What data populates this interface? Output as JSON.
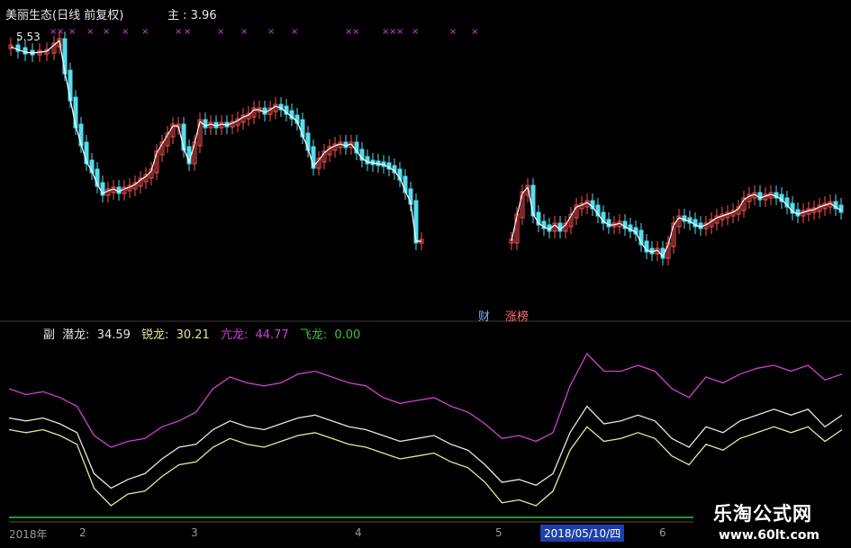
{
  "stock": {
    "title": "美丽生态(日线 前复权)",
    "main_label": "主 : 3.96",
    "price_high_label": "5.53"
  },
  "sub_indicators": {
    "panel_label": "副",
    "items": [
      {
        "label": "潜龙:",
        "value": "34.59",
        "color": "#e6e6e6"
      },
      {
        "label": "锐龙:",
        "value": "30.21",
        "color": "#e6e6a0"
      },
      {
        "label": "亢龙:",
        "value": "44.77",
        "color": "#d040d0"
      },
      {
        "label": "飞龙:",
        "value": "0.00",
        "color": "#40c040"
      }
    ]
  },
  "event_tags": {
    "finance": "财",
    "limit_list": "涨榜"
  },
  "date_axis": {
    "ticks": [
      "2018年",
      "2",
      "3",
      "4",
      "5",
      "6"
    ],
    "selected_date": "2018/05/10/四"
  },
  "watermark": {
    "brand": "乐淘公式网",
    "url": "www.60lt.com"
  },
  "colors": {
    "up_candle": "#ff5050",
    "down_candle": "#55ddee",
    "price_line": "#ffffff",
    "qianlong": "#e6e6e6",
    "ruilong": "#e6e6a0",
    "kanglong": "#d040d0",
    "feilong": "#40c040",
    "marker": "#d040d0"
  },
  "chart_data": {
    "type": "line",
    "series": [
      {
        "name": "亢龙",
        "values": [
          44,
          42,
          43,
          41,
          38,
          28,
          24,
          26,
          27,
          31,
          33,
          36,
          44,
          48,
          46,
          45,
          46,
          49,
          50,
          48,
          46,
          45,
          41,
          39,
          40,
          41,
          38,
          36,
          32,
          27,
          28,
          26,
          29,
          45,
          56,
          50,
          50,
          52,
          50,
          44,
          41,
          48,
          46,
          49,
          51,
          52,
          50,
          52,
          47,
          49
        ]
      },
      {
        "name": "潜龙",
        "values": [
          34,
          33,
          34,
          32,
          29,
          15,
          10,
          13,
          15,
          20,
          24,
          25,
          30,
          33,
          31,
          30,
          32,
          34,
          35,
          33,
          31,
          30,
          28,
          26,
          27,
          28,
          25,
          23,
          18,
          12,
          13,
          11,
          15,
          29,
          38,
          32,
          33,
          35,
          33,
          27,
          24,
          31,
          29,
          33,
          35,
          37,
          35,
          37,
          31,
          35
        ]
      },
      {
        "name": "锐龙",
        "values": [
          30,
          29,
          30,
          28,
          25,
          10,
          4,
          8,
          9,
          14,
          18,
          19,
          24,
          27,
          25,
          24,
          26,
          28,
          29,
          27,
          25,
          24,
          22,
          20,
          21,
          22,
          19,
          17,
          12,
          5,
          6,
          4,
          9,
          23,
          31,
          26,
          27,
          29,
          27,
          21,
          18,
          25,
          23,
          27,
          29,
          31,
          29,
          31,
          26,
          30
        ]
      },
      {
        "name": "飞龙",
        "values": [
          0,
          0,
          0,
          0,
          0,
          0,
          0,
          0,
          0,
          0,
          0,
          0,
          0,
          0,
          0,
          0,
          0,
          0,
          0,
          0,
          0,
          0,
          0,
          0,
          0,
          0,
          0,
          0,
          0,
          0,
          0,
          0,
          0,
          0,
          0,
          0,
          0,
          0,
          0,
          0,
          0,
          0,
          0,
          0,
          0,
          0,
          0,
          0,
          0,
          0
        ]
      }
    ]
  }
}
